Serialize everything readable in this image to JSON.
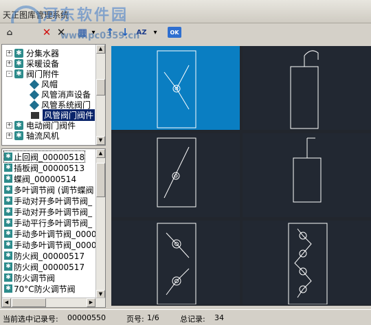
{
  "window": {
    "title": "天正图库管理系统",
    "watermark_text": "河东软件园",
    "watermark_url": "www.pc0359.cn"
  },
  "toolbar": {
    "buttons": [
      {
        "name": "home-button",
        "glyph": "⌂"
      },
      {
        "name": "delete-button",
        "glyph": "✕"
      },
      {
        "name": "close-button",
        "glyph": "✕"
      },
      {
        "name": "view-grid-button",
        "glyph": "▦"
      },
      {
        "name": "view-dropdown-button",
        "glyph": "▾"
      },
      {
        "name": "move-up-button",
        "glyph": "↑"
      },
      {
        "name": "move-down-button",
        "glyph": "↓"
      },
      {
        "name": "sort-button",
        "glyph": "AZ"
      },
      {
        "name": "sort-dropdown-button",
        "glyph": "▾"
      },
      {
        "name": "ok-button",
        "glyph": "OK"
      }
    ]
  },
  "tree": {
    "items": [
      {
        "label": "分集水器",
        "expander": "+",
        "icon": "node"
      },
      {
        "label": "采暖设备",
        "expander": "+",
        "icon": "node"
      },
      {
        "label": "阀门附件",
        "expander": "-",
        "icon": "node"
      },
      {
        "label": "风帽",
        "expander": "",
        "icon": "leaf"
      },
      {
        "label": "风管消声设备",
        "expander": "",
        "icon": "leaf"
      },
      {
        "label": "风管系统阀门",
        "expander": "",
        "icon": "leaf"
      },
      {
        "label": "风管阀门阀件",
        "expander": "",
        "icon": "leaf-open",
        "selected": true
      },
      {
        "label": "电动阀门阀件",
        "expander": "+",
        "icon": "node"
      },
      {
        "label": "轴流风机",
        "expander": "+",
        "icon": "node"
      }
    ]
  },
  "list": {
    "items": [
      "止回阀_00000518",
      "插板阀_00000513",
      "蝶阀_00000514",
      "多叶调节阀 (调节蝶阀",
      "手动对开多叶调节阀_",
      "手动对开多叶调节阀_",
      "手动平行多叶调节阀_",
      "手动多叶调节阀_0000",
      "手动多叶调节阀_0000",
      "防火阀_00000517",
      "防火阀_00000517",
      "防火调节阀",
      "70°C防火调节阀"
    ]
  },
  "statusbar": {
    "record_label": "当前选中记录号:",
    "record_value": "00000550",
    "page_label": "页号:",
    "page_value": "1/6",
    "total_label": "总记录:",
    "total_value": "34"
  },
  "colors": {
    "selected_cell": "#0a7ec2",
    "cell_bg": "#222832",
    "line": "#ffffff"
  }
}
